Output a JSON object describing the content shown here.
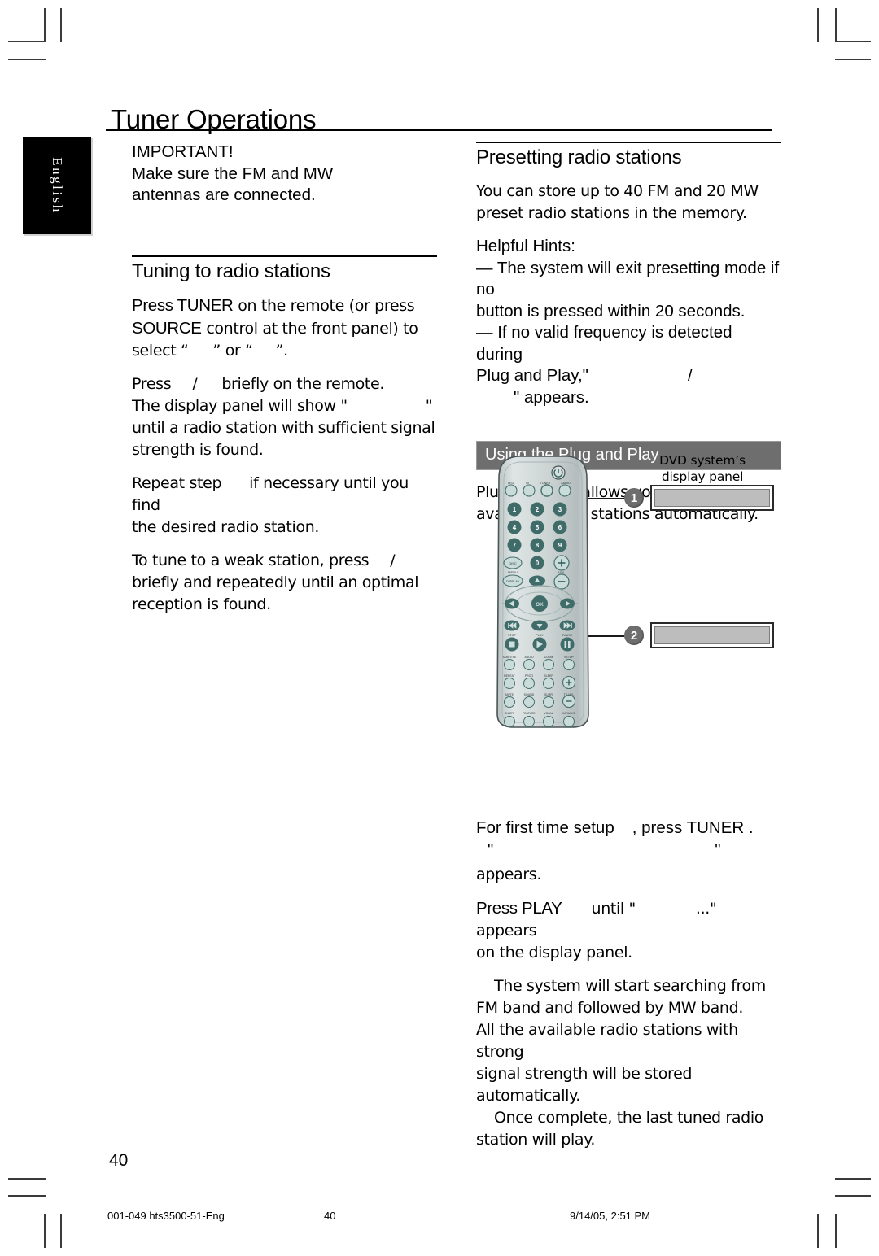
{
  "page": {
    "title": "Tuner Operations",
    "language_tab": "English",
    "page_number": "40"
  },
  "left_column": {
    "important": {
      "heading": "IMPORTANT!",
      "line1": "Make sure the FM and MW",
      "line2": "antennas are connected."
    },
    "tuning": {
      "heading": "Tuning to radio stations",
      "p1_a": "Press TUNER",
      "p1_b": "on the remote (or press",
      "p1_c": "SOURCE",
      "p1_d": "control at the front panel) to",
      "p1_e": "select “",
      "p1_f": "” or “",
      "p1_g": "”.",
      "p2_a": "Press",
      "p2_slash": "/",
      "p2_b": "briefly on the remote.",
      "p2_c": "The display panel will show \"",
      "p2_d": "\"",
      "p2_e": "until a radio station with sufficient signal",
      "p2_f": "strength is found.",
      "p3_a": "Repeat step",
      "p3_b": "if necessary until you find",
      "p3_c": "the desired radio station.",
      "p4_a": "To tune to a weak station, press",
      "p4_slash": "/",
      "p4_b": "briefly and repeatedly until an optimal",
      "p4_c": "reception is found."
    }
  },
  "right_column": {
    "presetting": {
      "heading": "Presetting radio stations",
      "p1_line1": "You can store up to 40 FM and 20 MW",
      "p1_line2": "preset radio stations in the memory.",
      "hints_heading": "Helpful Hints:",
      "hint1_line1": "—  The system will exit presetting mode if no",
      "hint1_line2": "button is pressed within 20 seconds.",
      "hint2_line1": "—  If no valid frequency is detected during",
      "hint2_line2a": "Plug and Play,\"",
      "hint2_line2b": "/",
      "hint2_line3": "\" appears."
    },
    "plug_and_play": {
      "banner": "Using the Plug and Play",
      "p1_line1": "Plug and Play allows you to store all",
      "p1_line2": "available radio stations automatically.",
      "s1_a": "For first time setup",
      "s1_b": ", press TUNER .",
      "s1_quote_open": "\"",
      "s1_quote_close": "\"",
      "s1_c": "appears.",
      "s2_a": "Press PLAY",
      "s2_b": "until \"",
      "s2_c": "...\" appears",
      "s2_d": "on the display panel.",
      "s3_line1": "The system will start searching from",
      "s3_line2": "FM band and followed by MW band.",
      "s3_line3": "All the available radio stations with strong",
      "s3_line4": "signal strength will be stored",
      "s3_line5": "automatically.",
      "s4_line1": "Once complete, the last tuned radio",
      "s4_line2": "station will play."
    }
  },
  "figure": {
    "display_caption_line1": "DVD system’s",
    "display_caption_line2": "display panel",
    "callout_1": "1",
    "callout_2": "2",
    "remote": {
      "power_icon": "power-icon",
      "source_row": [
        "DISC",
        "TV",
        "TUNER",
        "AUDIO"
      ],
      "numeric": [
        "1",
        "2",
        "3",
        "4",
        "5",
        "6",
        "7",
        "8",
        "9"
      ],
      "zero": "0",
      "disc_menu_line1": "DISC",
      "disc_menu_line2": "MENU",
      "display_button": "DISPLAY",
      "vol_label": "VOL",
      "vol_plus": "+",
      "vol_minus": "−",
      "ok_button": "OK",
      "transport_row": [
        "STOP",
        "PLAY",
        "PAUSE"
      ],
      "feature_row_1": [
        "SUBTITLE",
        "AUDIO",
        "ZOOM",
        "SETUP"
      ],
      "feature_row_2": [
        "REPEAT",
        "PROG",
        "SLEEP"
      ],
      "feature_row_3": [
        "MUTE",
        "SOUND",
        "SURR",
        "TV VOL"
      ],
      "feature_row_4": [
        "ON/OFF",
        "FEATURE",
        "VOCAL",
        "KARAOKE"
      ]
    }
  },
  "footer": {
    "file": "001-049 hts3500-51-Eng",
    "page": "40",
    "date": "9/14/05, 2:51 PM"
  },
  "colors": {
    "banner_bg": "#6e6e6e",
    "callout_bg": "#6e6e6e",
    "lcd_fill": "#bdbdbd",
    "remote_body": "#cfd6d6",
    "remote_button_dark": "#46706e",
    "tab_bg": "#000000"
  }
}
